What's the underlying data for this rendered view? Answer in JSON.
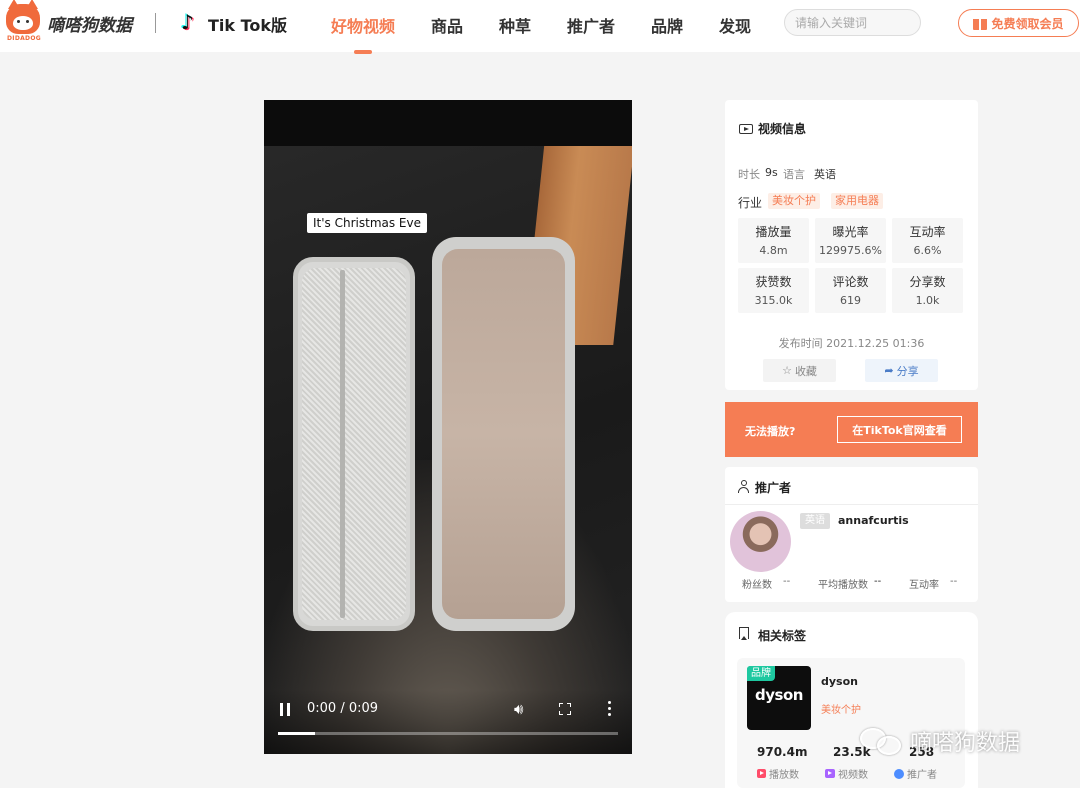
{
  "header": {
    "logo_subtext": "DIDADOG",
    "brand_name": "嘀嗒狗数据",
    "platform_label": "Tik Tok版",
    "nav": [
      "好物视频",
      "商品",
      "种草",
      "推广者",
      "品牌",
      "发现"
    ],
    "active_nav": "好物视频",
    "search_placeholder": "请输入关键词",
    "vip_button": "免费领取会员",
    "accent_color": "#f57d54"
  },
  "video": {
    "caption": "It's Christmas Eve",
    "time": "0:00 / 0:09",
    "progress_fraction": 0.11
  },
  "video_info": {
    "title": "视频信息",
    "duration_label": "时长",
    "duration_value": "9s",
    "language_label": "语言",
    "language_value": "英语",
    "industry_label": "行业",
    "industry_tags": [
      "美妆个护",
      "家用电器"
    ],
    "stats": [
      {
        "label": "播放量",
        "value": "4.8m"
      },
      {
        "label": "曝光率",
        "value": "129975.6%"
      },
      {
        "label": "互动率",
        "value": "6.6%"
      },
      {
        "label": "获赞数",
        "value": "315.0k"
      },
      {
        "label": "评论数",
        "value": "619"
      },
      {
        "label": "分享数",
        "value": "1.0k"
      }
    ],
    "publish_time": "发布时间 2021.12.25 01:36",
    "favorite_label": "收藏",
    "share_label": "分享"
  },
  "cta": {
    "text": "无法播放?",
    "button": "在TikTok官网查看"
  },
  "promoter": {
    "title": "推广者",
    "language_badge": "英语",
    "handle": "annafcurtis",
    "followers_label": "粉丝数",
    "followers_value": "--",
    "avg_views_label": "平均播放数",
    "avg_views_value": "--",
    "engagement_label": "互动率",
    "engagement_value": "--"
  },
  "tags": {
    "title": "相关标签",
    "brand_badge": "品牌",
    "brand_logo_text": "dyson",
    "brand_name": "dyson",
    "brand_category": "美妆个护",
    "stats": [
      {
        "value": "970.4m",
        "label": "播放数",
        "icon": "play-icon"
      },
      {
        "value": "23.5k",
        "label": "视频数",
        "icon": "video-icon"
      },
      {
        "value": "258",
        "label": "推广者",
        "icon": "promoter-icon"
      }
    ]
  },
  "watermark": {
    "text": "嘀嗒狗数据",
    "icon": "wechat-icon"
  }
}
